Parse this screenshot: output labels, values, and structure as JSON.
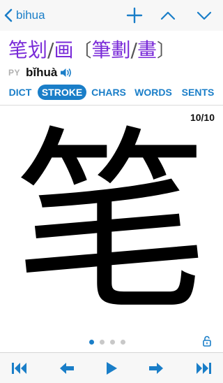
{
  "nav": {
    "back_label": "bihua",
    "back_icon": "chevron-left-icon",
    "add_icon": "plus-icon",
    "prev_icon": "chevron-up-icon",
    "next_icon": "chevron-down-icon",
    "accent": "#1a7ec8"
  },
  "entry": {
    "simplified": "笔划",
    "slash1": "/",
    "simplified_alt": "画",
    "bracket_open": "〔",
    "traditional": "筆劃",
    "slash2": "/",
    "traditional_alt": "畫",
    "bracket_close": "〕",
    "pinyin_label": "PY",
    "pinyin": "bǐhuà",
    "speaker_icon": "speaker-icon",
    "hanzi_color": "#7a2bd8"
  },
  "tabs": [
    {
      "label": "DICT",
      "active": false
    },
    {
      "label": "STROKE",
      "active": true
    },
    {
      "label": "CHARS",
      "active": false
    },
    {
      "label": "WORDS",
      "active": false
    },
    {
      "label": "SENTS",
      "active": false
    }
  ],
  "stroke": {
    "counter": "10/10",
    "character": "笔",
    "current_stroke": 10,
    "total_strokes": 10
  },
  "pager": {
    "pages": 4,
    "active_index": 0
  },
  "lock_icon": "unlock-icon",
  "toolbar": {
    "first_icon": "skip-first-icon",
    "prev_icon": "arrow-left-icon",
    "play_icon": "play-icon",
    "next_icon": "arrow-right-icon",
    "last_icon": "skip-last-icon"
  }
}
